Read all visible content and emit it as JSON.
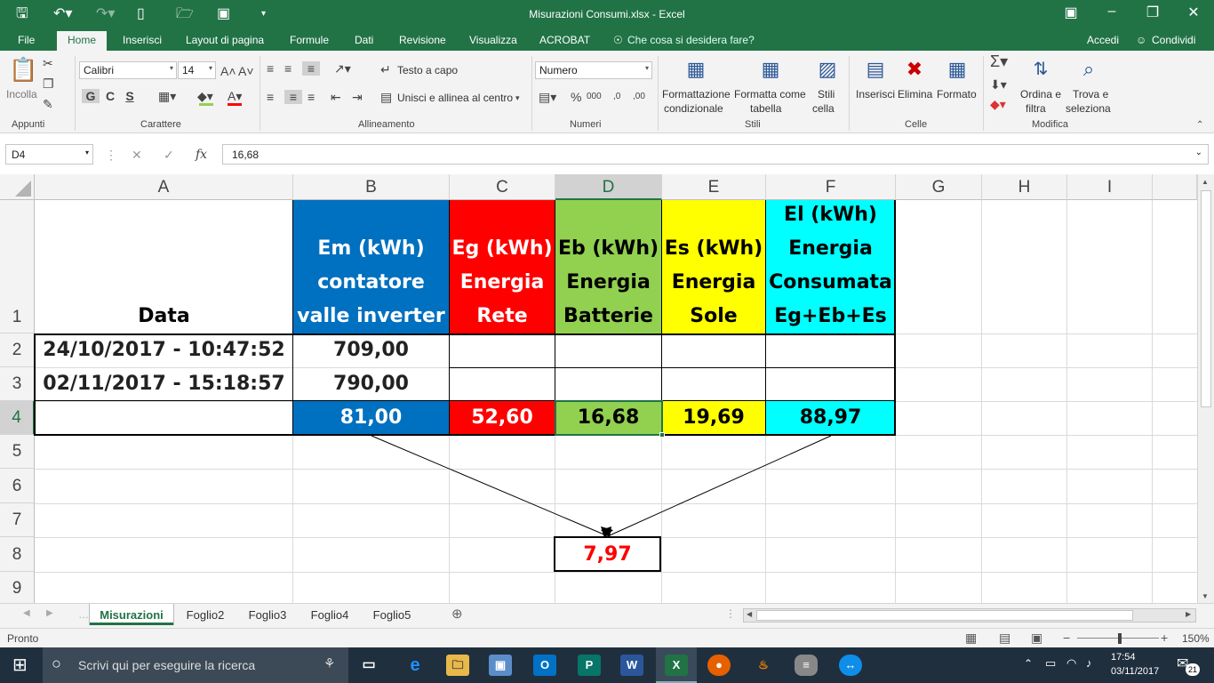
{
  "window": {
    "title": "Misurazioni Consumi.xlsx - Excel"
  },
  "tabs": [
    "File",
    "Home",
    "Inserisci",
    "Layout di pagina",
    "Formule",
    "Dati",
    "Revisione",
    "Visualizza",
    "ACROBAT"
  ],
  "tell_me": "Che cosa si desidera fare?",
  "account": {
    "signin": "Accedi",
    "share": "Condividi"
  },
  "ribbon": {
    "clipboard": {
      "paste": "Incolla",
      "label": "Appunti"
    },
    "font": {
      "name": "Calibri",
      "size": "14",
      "bold": "G",
      "italic": "C",
      "underline": "S",
      "label": "Carattere"
    },
    "alignment": {
      "wrap": "Testo a capo",
      "merge": "Unisci e allinea al centro",
      "label": "Allineamento"
    },
    "number": {
      "format": "Numero",
      "label": "Numeri"
    },
    "styles": {
      "cond1": "Formattazione",
      "cond2": "condizionale",
      "table1": "Formatta come",
      "table2": "tabella",
      "cell1": "Stili",
      "cell2": "cella",
      "label": "Stili"
    },
    "cells": {
      "insert": "Inserisci",
      "delete": "Elimina",
      "format": "Formato",
      "label": "Celle"
    },
    "editing": {
      "sort1": "Ordina e",
      "sort2": "filtra",
      "find1": "Trova e",
      "find2": "seleziona",
      "label": "Modifica"
    }
  },
  "formula_bar": {
    "name_box": "D4",
    "fx": "fx",
    "value": "16,68"
  },
  "columns": [
    "A",
    "B",
    "C",
    "D",
    "E",
    "F",
    "G",
    "H",
    "I"
  ],
  "rows": [
    "1",
    "2",
    "3",
    "4",
    "5",
    "6",
    "7",
    "8",
    "9"
  ],
  "cells": {
    "A1": "Data",
    "B1": [
      "Em  (kWh)",
      "contatore",
      "valle inverter"
    ],
    "C1": [
      "Eg (kWh)",
      "Energia",
      "Rete"
    ],
    "D1": [
      "Eb (kWh)",
      "Energia",
      "Batterie"
    ],
    "E1": [
      "Es (kWh)",
      "Energia",
      "Sole"
    ],
    "F1": [
      "El (kWh)",
      "Energia",
      "Consumata",
      "Eg+Eb+Es"
    ],
    "A2": "24/10/2017 - 10:47:52",
    "B2": "709,00",
    "A3": "02/11/2017 - 15:18:57",
    "B3": "790,00",
    "B4": "81,00",
    "C4": "52,60",
    "D4": "16,68",
    "E4": "19,69",
    "F4": "88,97",
    "D8": "7,97"
  },
  "colors": {
    "blue": "#0070c0",
    "red": "#ff0000",
    "green": "#92d050",
    "yellow": "#ffff00",
    "cyan": "#00ffff",
    "excel": "#217346"
  },
  "sheets": [
    "Misurazioni",
    "Foglio2",
    "Foglio3",
    "Foglio4",
    "Foglio5"
  ],
  "status": {
    "ready": "Pronto",
    "zoom": "150%"
  },
  "taskbar": {
    "search": "Scrivi qui per eseguire la ricerca",
    "time": "17:54",
    "date": "03/11/2017",
    "badge": "21"
  }
}
